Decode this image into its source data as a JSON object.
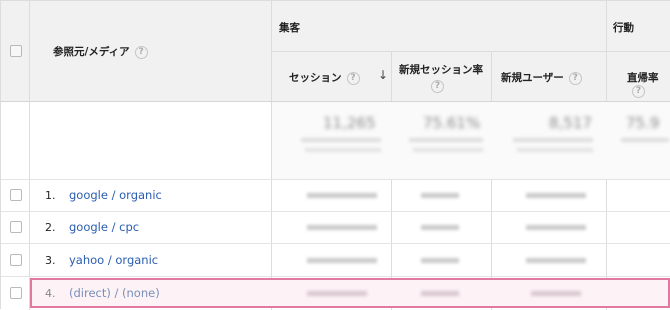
{
  "header": {
    "dimension_label": "参照元/メディア",
    "group_acquisition": "集客",
    "group_behavior": "行動",
    "sort_arrow": "↓",
    "columns": [
      "セッション",
      "新規セッション率",
      "新規ユーザー",
      "直帰率"
    ]
  },
  "totals": {
    "sessions": "11,265",
    "new_session_rate": "75.61%",
    "new_users": "8,517",
    "bounce_rate": "75.9"
  },
  "rows": [
    {
      "index": "1.",
      "source": "google / organic",
      "highlighted": false
    },
    {
      "index": "2.",
      "source": "google / cpc",
      "highlighted": false
    },
    {
      "index": "3.",
      "source": "yahoo / organic",
      "highlighted": false
    },
    {
      "index": "4.",
      "source": "(direct) / (none)",
      "highlighted": true
    }
  ],
  "colors": {
    "highlight_border": "#e07aa0",
    "highlight_bg": "#fdf2f6",
    "link": "#2a5db0"
  }
}
